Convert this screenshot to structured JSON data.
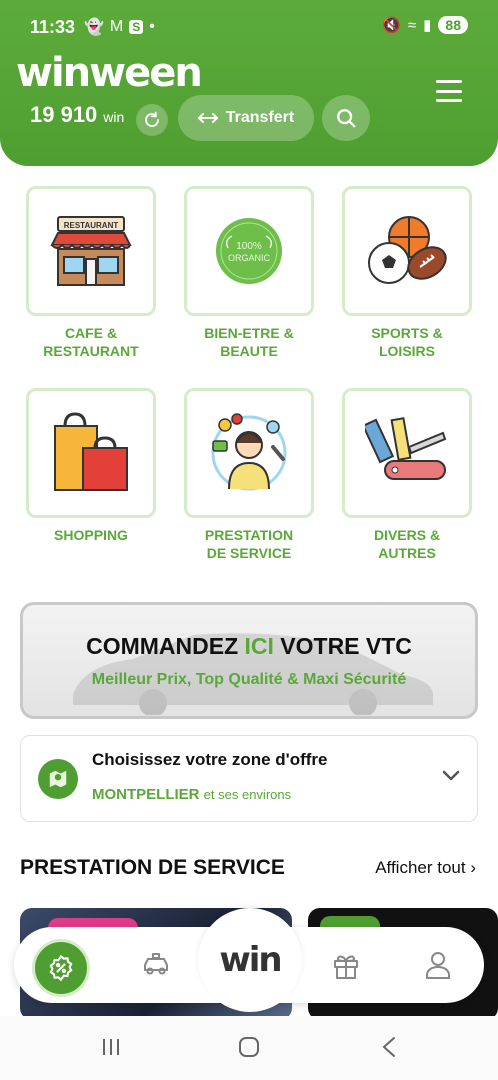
{
  "status_bar": {
    "time": "11:33",
    "battery": "88"
  },
  "header": {
    "logo": "winween",
    "balance_value": "19 910",
    "balance_unit": "win",
    "transfer_label": "Transfert"
  },
  "categories": [
    {
      "label_line1": "CAFE &",
      "label_line2": "RESTAURANT",
      "icon": "restaurant-icon"
    },
    {
      "label_line1": "BIEN-ETRE &",
      "label_line2": "BEAUTE",
      "icon": "organic-icon"
    },
    {
      "label_line1": "SPORTS &",
      "label_line2": "LOISIRS",
      "icon": "sports-balls-icon"
    },
    {
      "label_line1": "SHOPPING",
      "label_line2": "",
      "icon": "shopping-bags-icon"
    },
    {
      "label_line1": "PRESTATION",
      "label_line2": "DE SERVICE",
      "icon": "service-person-icon"
    },
    {
      "label_line1": "DIVERS &",
      "label_line2": "AUTRES",
      "icon": "tools-icon"
    }
  ],
  "organic_badge": {
    "line1": "100%",
    "line2": "ORGANIC"
  },
  "vtc_banner": {
    "title_before": "COMMANDEZ ",
    "title_highlight": "ICI",
    "title_after": " VOTRE VTC",
    "subtitle": "Meilleur Prix, Top Qualité & Maxi Sécurité"
  },
  "zone": {
    "title": "Choisissez votre zone d'offre",
    "city": "MONTPELLIER",
    "suffix": "et ses environs"
  },
  "section": {
    "title": "PRESTATION DE SERVICE",
    "link": "Afficher tout"
  },
  "bottom_nav": {
    "center_logo": "win"
  },
  "colors": {
    "brand_green": "#4f9e31",
    "label_green": "#5aa838",
    "border_green": "#d5ecc8"
  }
}
